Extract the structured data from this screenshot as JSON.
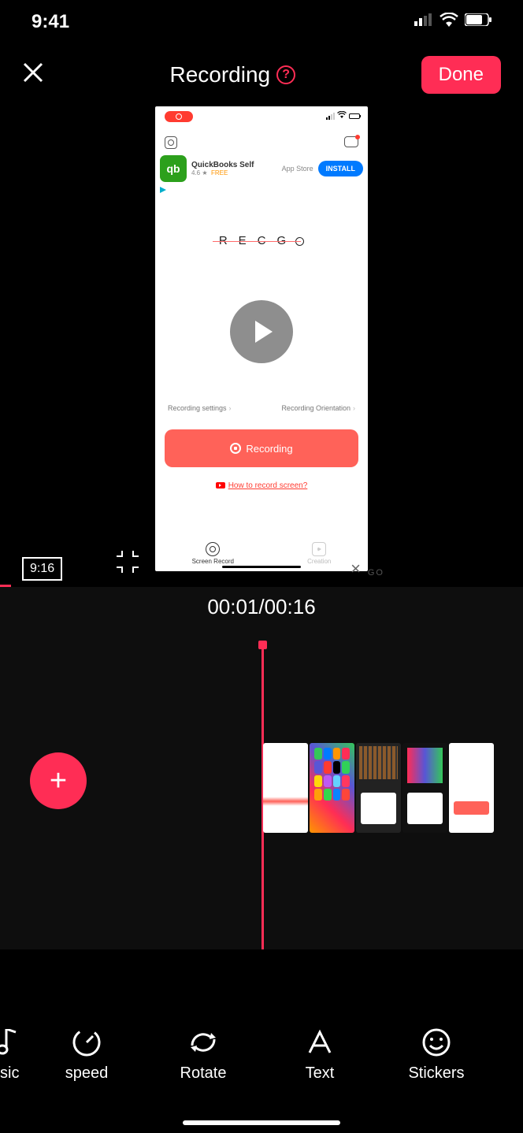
{
  "status": {
    "time": "9:41"
  },
  "header": {
    "title": "Recording",
    "done": "Done"
  },
  "preview": {
    "ad": {
      "title": "QuickBooks Self",
      "rating": "4.6 ★",
      "price": "FREE",
      "store": "App Store",
      "install": "INSTALL"
    },
    "logo": "RECG",
    "settings": {
      "left": "Recording settings",
      "right": "Recording Orientation"
    },
    "record_btn": "Recording",
    "howto": "How to record screen?",
    "tabs": {
      "left": "Screen Record",
      "right": "Creation"
    },
    "aspect": "9:16",
    "watermark": "GO"
  },
  "timeline": {
    "time": "00:01/00:16"
  },
  "tools": {
    "music": "sic",
    "speed": "speed",
    "rotate": "Rotate",
    "text": "Text",
    "stickers": "Stickers"
  }
}
